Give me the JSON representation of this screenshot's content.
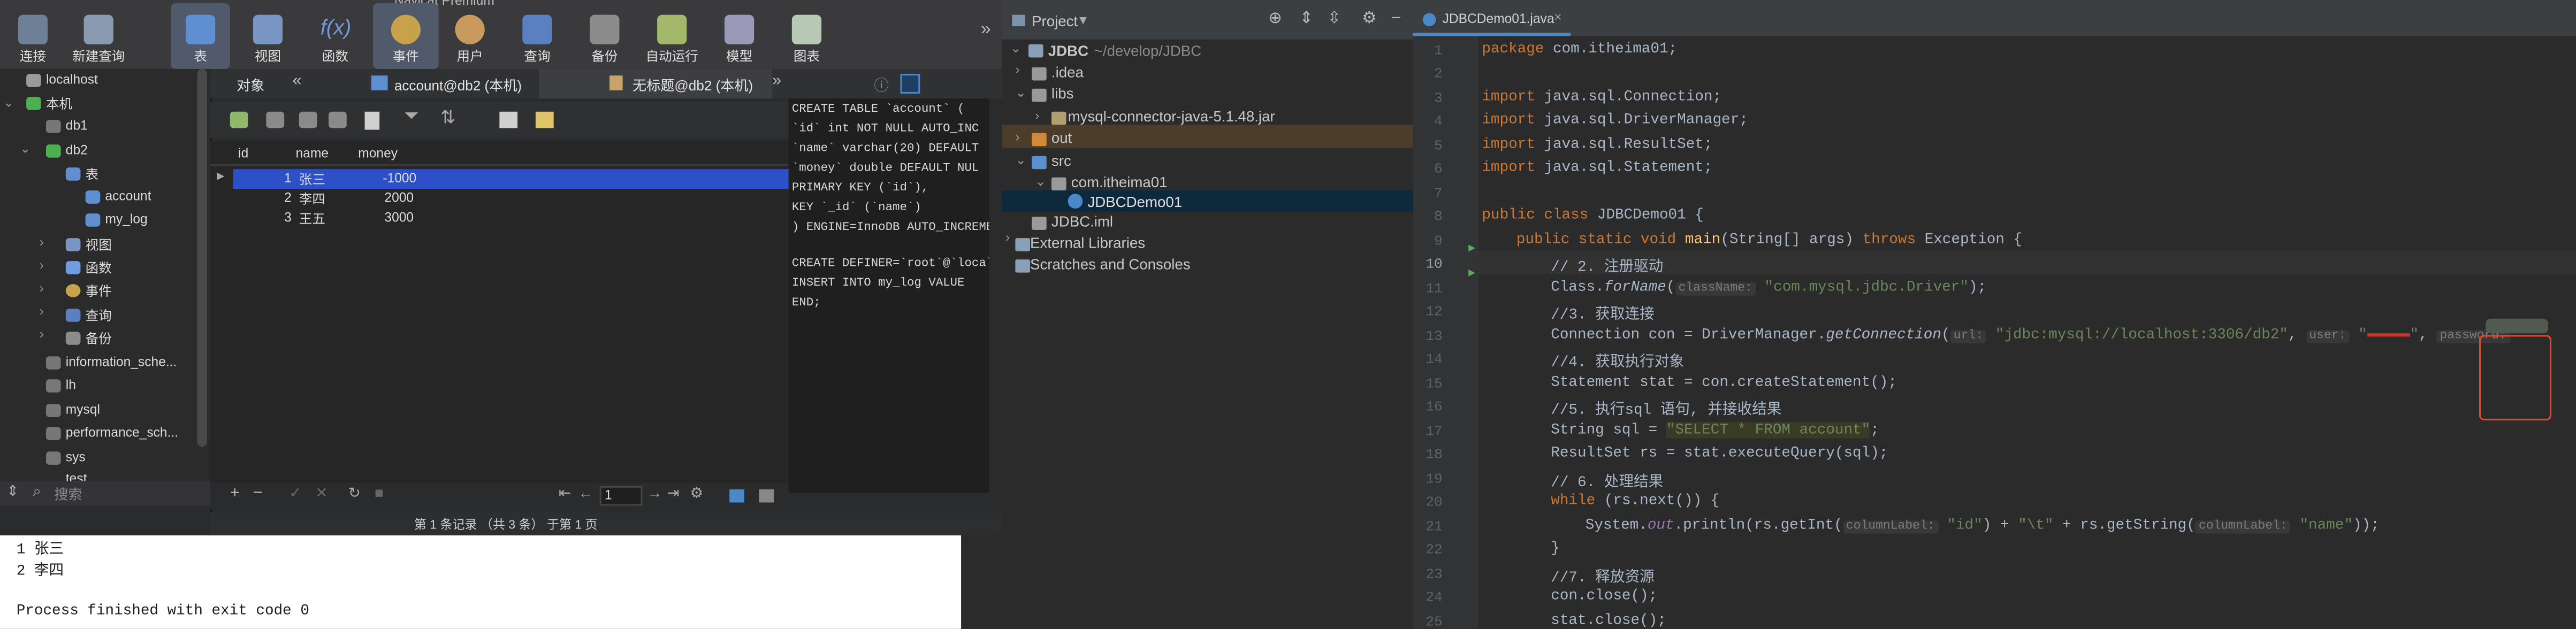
{
  "colors": {
    "selection": "#2d50c8",
    "accent": "#4a88c7",
    "warning_box": "#e04a2a"
  },
  "navicat": {
    "window_title": "Navicat Premium",
    "toolbar": [
      {
        "label": "连接",
        "icon": "connect-icon"
      },
      {
        "label": "新建查询",
        "icon": "new-query-icon"
      },
      {
        "label": "表",
        "icon": "table-icon"
      },
      {
        "label": "视图",
        "icon": "view-icon"
      },
      {
        "label": "函数",
        "icon": "function-icon"
      },
      {
        "label": "事件",
        "icon": "event-clock-icon"
      },
      {
        "label": "用户",
        "icon": "user-icon"
      },
      {
        "label": "查询",
        "icon": "query-icon"
      },
      {
        "label": "备份",
        "icon": "backup-icon"
      },
      {
        "label": "自动运行",
        "icon": "automation-icon"
      },
      {
        "label": "模型",
        "icon": "model-icon"
      },
      {
        "label": "图表",
        "icon": "chart-icon"
      }
    ],
    "tree": {
      "localhost": "localhost",
      "local": "本机",
      "db1": "db1",
      "db2": "db2",
      "tables": "表",
      "account": "account",
      "my_log": "my_log",
      "views": "视图",
      "functions": "函数",
      "events": "事件",
      "queries": "查询",
      "backups": "备份",
      "information_schema": "information_sche...",
      "lh": "lh",
      "mysql": "mysql",
      "performance_schema": "performance_sch...",
      "sys": "sys",
      "test": "test"
    },
    "search_placeholder": "搜索",
    "tabs": {
      "objects": "对象",
      "account": "account@db2 (本机)",
      "untitled": "无标题@db2 (本机)"
    },
    "grid": {
      "columns": [
        "id",
        "name",
        "money"
      ],
      "rows": [
        {
          "id": "1",
          "name": "张三",
          "money": "-1000"
        },
        {
          "id": "2",
          "name": "李四",
          "money": "2000"
        },
        {
          "id": "3",
          "name": "王五",
          "money": "3000"
        }
      ],
      "page": "1"
    },
    "ddl": [
      "CREATE TABLE `account` (",
      "  `id` int NOT NULL AUTO_INC",
      "  `name` varchar(20) DEFAULT",
      "  `money` double DEFAULT NUL",
      "  PRIMARY KEY (`id`),",
      "  KEY `_id` (`name`)",
      ") ENGINE=InnoDB AUTO_INCREME",
      "",
      "CREATE DEFINER=`root`@`local",
      "    INSERT INTO my_log VALUE",
      "  END;"
    ],
    "status": "第 1 条记录 （共 3 条） 于第 1 页"
  },
  "console": {
    "lines": [
      "1   张三",
      "2   李四",
      "",
      "Process finished with exit code 0"
    ]
  },
  "project": {
    "title": "Project",
    "root": "JDBC",
    "root_path": "~/develop/JDBC",
    "items": [
      ".idea",
      "libs",
      "mysql-connector-java-5.1.48.jar",
      "out",
      "src",
      "com.itheima01",
      "JDBCDemo01",
      "JDBC.iml",
      "External Libraries",
      "Scratches and Consoles"
    ]
  },
  "editor": {
    "tab": "JDBCDemo01.java",
    "line_numbers": [
      "1",
      "2",
      "3",
      "4",
      "5",
      "6",
      "7",
      "8",
      "9",
      "10",
      "11",
      "12",
      "13",
      "14",
      "15",
      "16",
      "17",
      "18",
      "19",
      "20",
      "21",
      "22",
      "23",
      "24",
      "25"
    ],
    "code": {
      "l1a": "package",
      "l1b": " com.itheima01;",
      "imp": "import",
      "l3": " java.sql.Connection;",
      "l4": " java.sql.DriverManager;",
      "l5": " java.sql.ResultSet;",
      "l6": " java.sql.Statement;",
      "l8a": "public class",
      "l8b": " JDBCDemo01 {",
      "l9a": "public static void",
      "l9b": " main",
      "l9c": "(String[] args) ",
      "l9d": "throws",
      "l9e": " Exception {",
      "l10": "// 2. 注册驱动",
      "l11a": "Class.",
      "l11b": "forName",
      "l11c": "(",
      "l11h": "className:",
      "l11d": "\"com.mysql.jdbc.Driver\"",
      "l11e": ");",
      "l12": "//3. 获取连接",
      "l13a": "Connection con =  DriverManager.",
      "l13b": "getConnection",
      "l13c": "(",
      "l13h1": "url:",
      "l13d": "\"jdbc:mysql://localhost:3306/db2\"",
      "l13e": ",",
      "l13h2": "user:",
      "l13f": "\"",
      "l13g": ",",
      "l13h3": "password:",
      "l13i": "\"",
      "l13j": ");",
      "l14": "//4. 获取执行对象",
      "l15": "Statement stat = con.createStatement();",
      "l16": "//5. 执行sql 语句,  并接收结果",
      "l17a": "String sql = ",
      "l17b": "\"SELECT * FROM account\"",
      "l17c": ";",
      "l18": "ResultSet rs = stat.executeQuery(sql);",
      "l19": "// 6.  处理结果",
      "l20a": "while",
      "l20b": " (rs.next()) {",
      "l21a": "System.",
      "l21b": "out",
      "l21c": ".println(rs.getInt(",
      "l21h1": "columnLabel:",
      "l21d": "\"id\"",
      "l21e": ") + ",
      "l21f": "\"\\t\"",
      "l21g": " + rs.getString(",
      "l21h2": "columnLabel:",
      "l21i": "\"name\"",
      "l21j": "));",
      "l22": "}",
      "l23": "//7.  释放资源",
      "l24": "con.close();",
      "l25": "stat.close();"
    }
  }
}
